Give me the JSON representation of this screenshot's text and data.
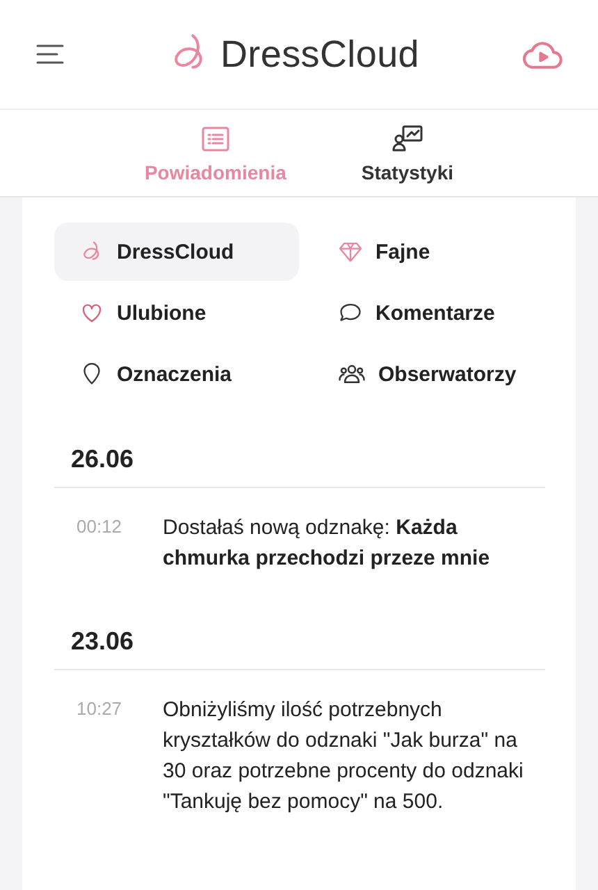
{
  "header": {
    "logo": "DressCloud"
  },
  "tabs": [
    {
      "label": "Powiadomienia",
      "kind": "list",
      "selected": true
    },
    {
      "label": "Statystyki",
      "kind": "stats",
      "selected": false
    }
  ],
  "filters": [
    {
      "label": "DressCloud",
      "kind": "logo",
      "selected": true
    },
    {
      "label": "Fajne",
      "kind": "diamond",
      "selected": false
    },
    {
      "label": "Ulubione",
      "kind": "heart",
      "selected": false
    },
    {
      "label": "Komentarze",
      "kind": "comment",
      "selected": false
    },
    {
      "label": "Oznaczenia",
      "kind": "pin",
      "selected": false
    },
    {
      "label": "Obserwatorzy",
      "kind": "people",
      "selected": false
    }
  ],
  "days": [
    {
      "date": "26.06",
      "items": [
        {
          "time": "00:12",
          "text": "Dostałaś nową odznakę: **Każda chmurka przechodzi przeze mnie**"
        }
      ]
    },
    {
      "date": "23.06",
      "items": [
        {
          "time": "10:27",
          "text": "Obniżyliśmy ilość potrzebnych kryształków do odznaki \"Jak burza\" na 30 oraz potrzebne procenty do odznaki \"Tankuję bez pomocy\" na 500."
        }
      ]
    }
  ]
}
